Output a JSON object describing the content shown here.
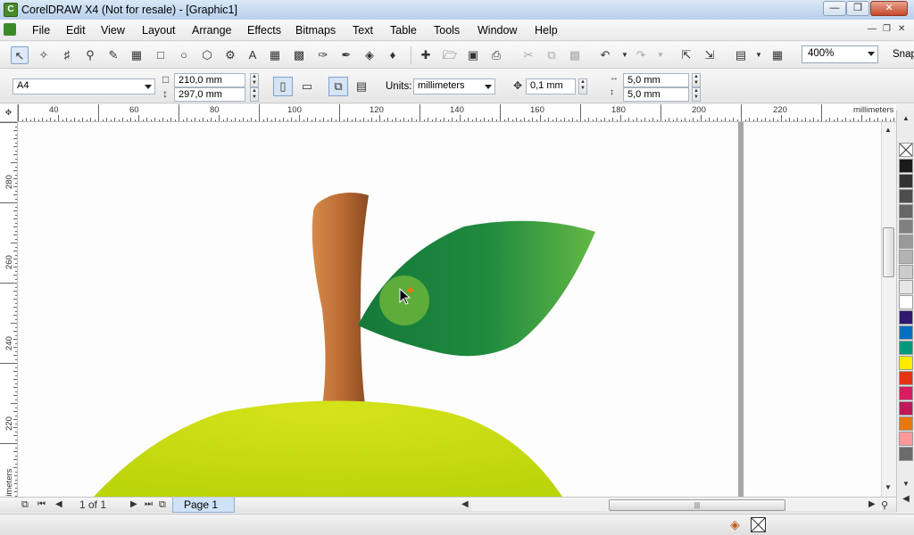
{
  "window": {
    "title": "CorelDRAW X4 (Not for resale) - [Graphic1]",
    "app_icon": "coreldraw-icon",
    "controls": [
      "minimize-icon",
      "restore-icon",
      "close-icon"
    ]
  },
  "menu": {
    "items": [
      "File",
      "Edit",
      "View",
      "Layout",
      "Arrange",
      "Effects",
      "Bitmaps",
      "Text",
      "Table",
      "Tools",
      "Window",
      "Help"
    ]
  },
  "toolbox": {
    "tools": [
      "pick-tool-icon",
      "shape-tool-icon",
      "crop-tool-icon",
      "zoom-tool-icon",
      "freehand-tool-icon",
      "smart-fill-icon",
      "rectangle-tool-icon",
      "ellipse-tool-icon",
      "polygon-tool-icon",
      "basic-shapes-icon",
      "text-tool-icon",
      "table-tool-icon",
      "blend-tool-icon",
      "eyedropper-icon",
      "outline-pen-icon",
      "fill-bucket-icon",
      "interactive-fill-icon"
    ]
  },
  "standard": {
    "tools": [
      "new-document-icon",
      "open-icon",
      "save-icon",
      "print-icon",
      "cut-icon",
      "copy-icon",
      "paste-icon",
      "undo-icon",
      "redo-icon",
      "import-icon",
      "export-icon",
      "app-launcher-icon",
      "welcome-screen-icon"
    ],
    "zoom": "400%",
    "snap_label": "Snap"
  },
  "property_bar": {
    "paper_type": "A4",
    "page_width": "210,0 mm",
    "page_height": "297,0 mm",
    "units_label": "Units:",
    "units_value": "millimeters",
    "nudge": "0,1 mm",
    "dup_x": "5,0 mm",
    "dup_y": "5,0 mm"
  },
  "ruler": {
    "h_labels": [
      "40",
      "60",
      "80",
      "100",
      "120",
      "140",
      "160",
      "180",
      "200",
      "220"
    ],
    "h_unit": "millimeters",
    "v_labels": [
      "280",
      "260",
      "240",
      "220"
    ],
    "v_unit": "millimeters"
  },
  "palette": {
    "colors": [
      "#1a1a1a",
      "#333333",
      "#4d4d4d",
      "#666666",
      "#808080",
      "#999999",
      "#b3b3b3",
      "#cccccc",
      "#e6e6e6",
      "#ffffff",
      "#2e1a6e",
      "#0070c0",
      "#009a7c",
      "#ffeb00",
      "#e63312",
      "#d81b60",
      "#c0185a",
      "#e8780a",
      "#ff9999",
      "#6b6b6b"
    ]
  },
  "page_navigator": {
    "page_count": "1 of 1",
    "page_tab": "Page 1"
  },
  "artwork": {
    "stem_color": "#b86a34",
    "leaf_color": "#1f8a3e",
    "leaf_highlight": "#6bb43a",
    "apple_color": "#c8dc0c"
  }
}
